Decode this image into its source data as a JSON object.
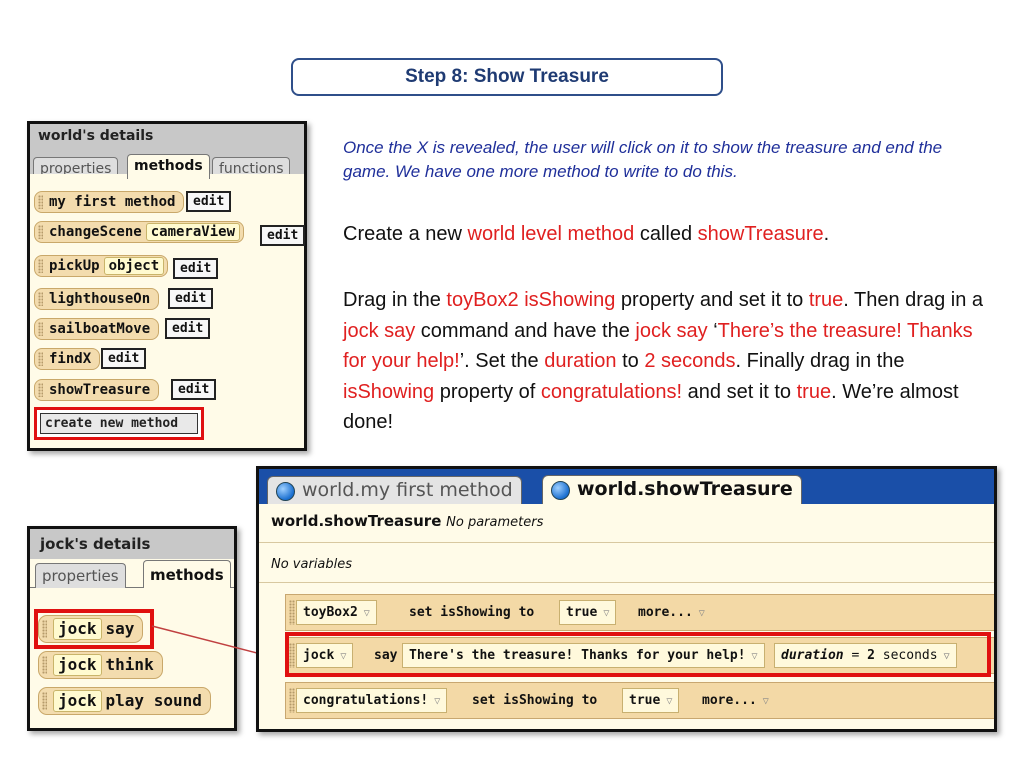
{
  "title": "Step 8: Show Treasure",
  "world_panel": {
    "header": "world's details",
    "tabs": [
      "properties",
      "methods",
      "functions"
    ],
    "methods": [
      {
        "name": "my first method",
        "param": "",
        "edit": "edit"
      },
      {
        "name": "changeScene",
        "param": "cameraView",
        "edit": "edit"
      },
      {
        "name": "pickUp",
        "param": "object",
        "edit": "edit"
      },
      {
        "name": "lighthouseOn",
        "param": "",
        "edit": "edit"
      },
      {
        "name": "sailboatMove",
        "param": "",
        "edit": "edit"
      },
      {
        "name": "findX",
        "param": "",
        "edit": "edit"
      },
      {
        "name": "showTreasure",
        "param": "",
        "edit": "edit"
      }
    ],
    "create_button": "create new method"
  },
  "intro": "Once the  X is revealed, the user will click on it to show the treasure and end the game. We have one more method to write to do this.",
  "para1": {
    "t1": "Create a new ",
    "r1": "world level method",
    "t2": " called ",
    "r2": "showTreasure",
    "t3": "."
  },
  "para2": {
    "t1": "Drag in the ",
    "r1": "toyBox2 isShowing",
    "t2": " property and set it to ",
    "r2": "true",
    "t3": ". Then drag in a ",
    "r3": "jock say",
    "t4": " command and have the ",
    "r4": "jock say",
    "t5": " ‘",
    "r5": "There’s the treasure! Thanks for your help!",
    "t6": "’. Set the ",
    "r6": "duration",
    "t7": " to ",
    "r7": "2 seconds",
    "t8": ". Finally drag in the ",
    "r8": "isShowing",
    "t9": " property of ",
    "r9": "congratulations!",
    "t10": " and set it to ",
    "r10": "true",
    "t11": ". We’re almost done!"
  },
  "jock_panel": {
    "header": "jock's details",
    "tabs": [
      "properties",
      "methods"
    ],
    "methods": [
      {
        "obj": "jock",
        "name": "say"
      },
      {
        "obj": "jock",
        "name": "think"
      },
      {
        "obj": "jock",
        "name": "play sound"
      }
    ]
  },
  "editor": {
    "tabs": [
      "world.my first method",
      "world.showTreasure"
    ],
    "method_name": "world.showTreasure",
    "params_text": "No parameters",
    "vars_text": "No variables",
    "statements": [
      {
        "obj": "toyBox2",
        "action": "set  isShowing  to",
        "value": "true",
        "more": "more..."
      },
      {
        "obj": "jock",
        "action": "say",
        "text": "There's the treasure! Thanks for your help!",
        "duration_label": "duration",
        "duration_eq": " = ",
        "duration_value": "2",
        "duration_unit": " seconds"
      },
      {
        "obj": "congratulations!",
        "action": "set  isShowing  to",
        "value": "true",
        "more": "more..."
      }
    ]
  },
  "colors": {
    "accent_red": "#e02020",
    "title_blue": "#1f3b73",
    "intro_blue": "#1f2f9a"
  }
}
